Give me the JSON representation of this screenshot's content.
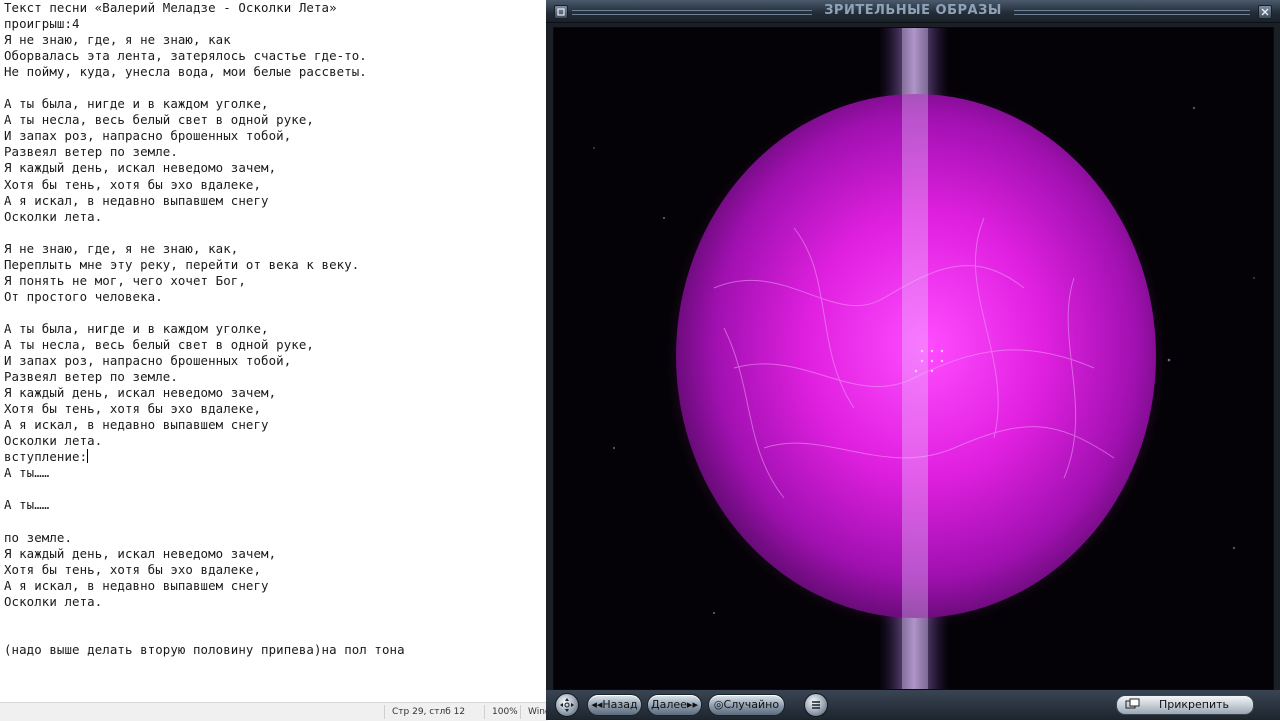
{
  "notepad": {
    "lines": [
      "Текст песни «Валерий Меладзе - Осколки Лета»",
      "проигрыш:4",
      "Я не знаю, где, я не знаю, как",
      "Оборвалась эта лента, затерялось счастье где-то.",
      "Не пойму, куда, унесла вода, мои белые рассветы.",
      "",
      "А ты была, нигде и в каждом уголке,",
      "А ты несла, весь белый свет в одной руке,",
      "И запах роз, напрасно брошенных тобой,",
      "Развеял ветер по земле.",
      "Я каждый день, искал неведомо зачем,",
      "Хотя бы тень, хотя бы эхо вдалеке,",
      "А я искал, в недавно выпавшем снегу",
      "Осколки лета.",
      "",
      "Я не знаю, где, я не знаю, как,",
      "Переплыть мне эту реку, перейти от века к веку.",
      "Я понять не мог, чего хочет Бог,",
      "От простого человека.",
      "",
      "А ты была, нигде и в каждом уголке,",
      "А ты несла, весь белый свет в одной руке,",
      "И запах роз, напрасно брошенных тобой,",
      "Развеял ветер по земле.",
      "Я каждый день, искал неведомо зачем,",
      "Хотя бы тень, хотя бы эхо вдалеке,",
      "А я искал, в недавно выпавшем снегу",
      "Осколки лета.",
      "вступление:",
      "А ты……",
      "",
      "А ты……",
      "",
      "по земле.",
      "Я каждый день, искал неведомо зачем,",
      "Хотя бы тень, хотя бы эхо вдалеке,",
      "А я искал, в недавно выпавшем снегу",
      "Осколки лета.",
      "",
      "",
      "(надо выше делать вторую половину припева)на пол тона"
    ],
    "caret_line": 28,
    "status": {
      "position": "Стр 29, стлб 12",
      "zoom": "100%",
      "line_ending": "Wind"
    }
  },
  "player": {
    "title": "ЗРИТЕЛЬНЫЕ ОБРАЗЫ",
    "controls": {
      "back_label": "Назад",
      "next_label": "Далее",
      "random_label": "Случайно",
      "pin_label": "Прикрепить"
    },
    "icons": [
      "move-icon",
      "back-arrows-icon",
      "next-arrows-icon",
      "random-icon",
      "list-icon",
      "pin-icon",
      "restore-icon",
      "close-icon"
    ],
    "colors": {
      "orb": "#e020e0",
      "beam": "#c8a0ff",
      "background": "#040206"
    }
  }
}
